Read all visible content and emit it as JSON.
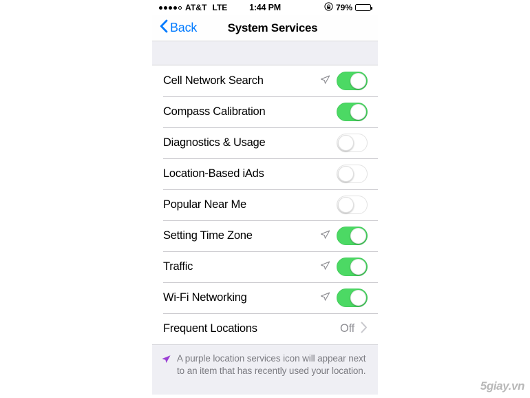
{
  "status_bar": {
    "signal_dots_filled": 4,
    "signal_dots_total": 5,
    "carrier": "AT&T",
    "network": "LTE",
    "time": "1:44 PM",
    "battery_percent": "79%",
    "battery_level": 0.79,
    "orientation_lock_icon": "rotation-lock-icon"
  },
  "nav": {
    "back_label": "Back",
    "title": "System Services",
    "back_icon": "chevron-left-icon",
    "accent_color": "#007AFF"
  },
  "colors": {
    "toggle_on": "#4CD964",
    "group_background": "#EFEFF4",
    "separator": "#C8C7CC",
    "secondary_text": "#8E8E93",
    "location_arrow_gray": "#8E8E93",
    "location_arrow_purple": "#9B3FD4"
  },
  "list": {
    "rows": [
      {
        "label": "Cell Network Search",
        "control": "toggle",
        "value": "on",
        "location_arrow": "gray"
      },
      {
        "label": "Compass Calibration",
        "control": "toggle",
        "value": "on",
        "location_arrow": "none"
      },
      {
        "label": "Diagnostics & Usage",
        "control": "toggle",
        "value": "off",
        "location_arrow": "none"
      },
      {
        "label": "Location-Based iAds",
        "control": "toggle",
        "value": "off",
        "location_arrow": "none"
      },
      {
        "label": "Popular Near Me",
        "control": "toggle",
        "value": "off",
        "location_arrow": "none"
      },
      {
        "label": "Setting Time Zone",
        "control": "toggle",
        "value": "on",
        "location_arrow": "gray"
      },
      {
        "label": "Traffic",
        "control": "toggle",
        "value": "on",
        "location_arrow": "gray"
      },
      {
        "label": "Wi-Fi Networking",
        "control": "toggle",
        "value": "on",
        "location_arrow": "gray"
      },
      {
        "label": "Frequent Locations",
        "control": "disclosure",
        "value": "Off",
        "location_arrow": "none"
      }
    ]
  },
  "footer": {
    "icon": "location-arrow-icon",
    "text": "A purple location services icon will appear next to an item that has recently used your location."
  },
  "watermark": {
    "text": "5giay.vn"
  }
}
